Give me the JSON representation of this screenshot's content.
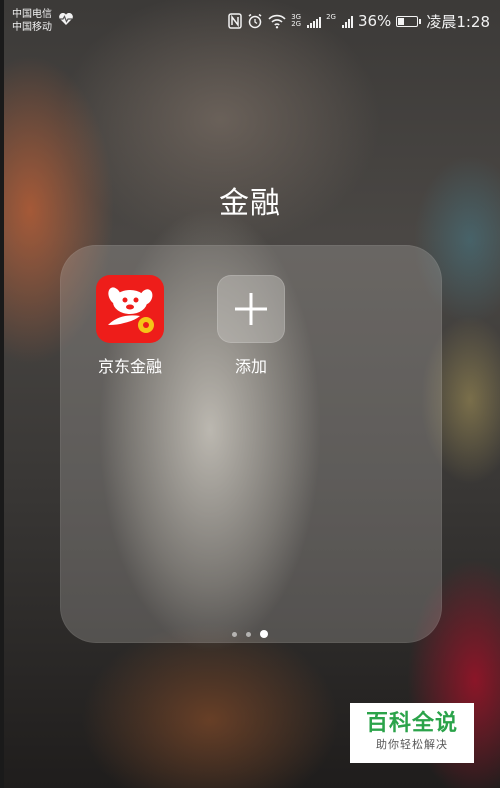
{
  "status_bar": {
    "carrier_1": "中国电信",
    "carrier_2": "中国移动",
    "net_1_top": "3G",
    "net_1_bottom": "2G",
    "net_2": "2G",
    "battery_percent": "36%",
    "time": "凌晨1:28",
    "battery_level": 0.36
  },
  "folder": {
    "title": "金融",
    "apps": [
      {
        "label": "京东金融",
        "icon": "jd-finance-icon"
      },
      {
        "label": "添加",
        "icon": "plus-icon"
      }
    ],
    "pages": 3,
    "current_page": 3
  },
  "watermark": {
    "title": "百科全说",
    "subtitle": "助你轻松解决"
  },
  "colors": {
    "jd_red": "#ee1d1a",
    "coin_yellow": "#f5c518",
    "watermark_green": "#2ba34a"
  }
}
